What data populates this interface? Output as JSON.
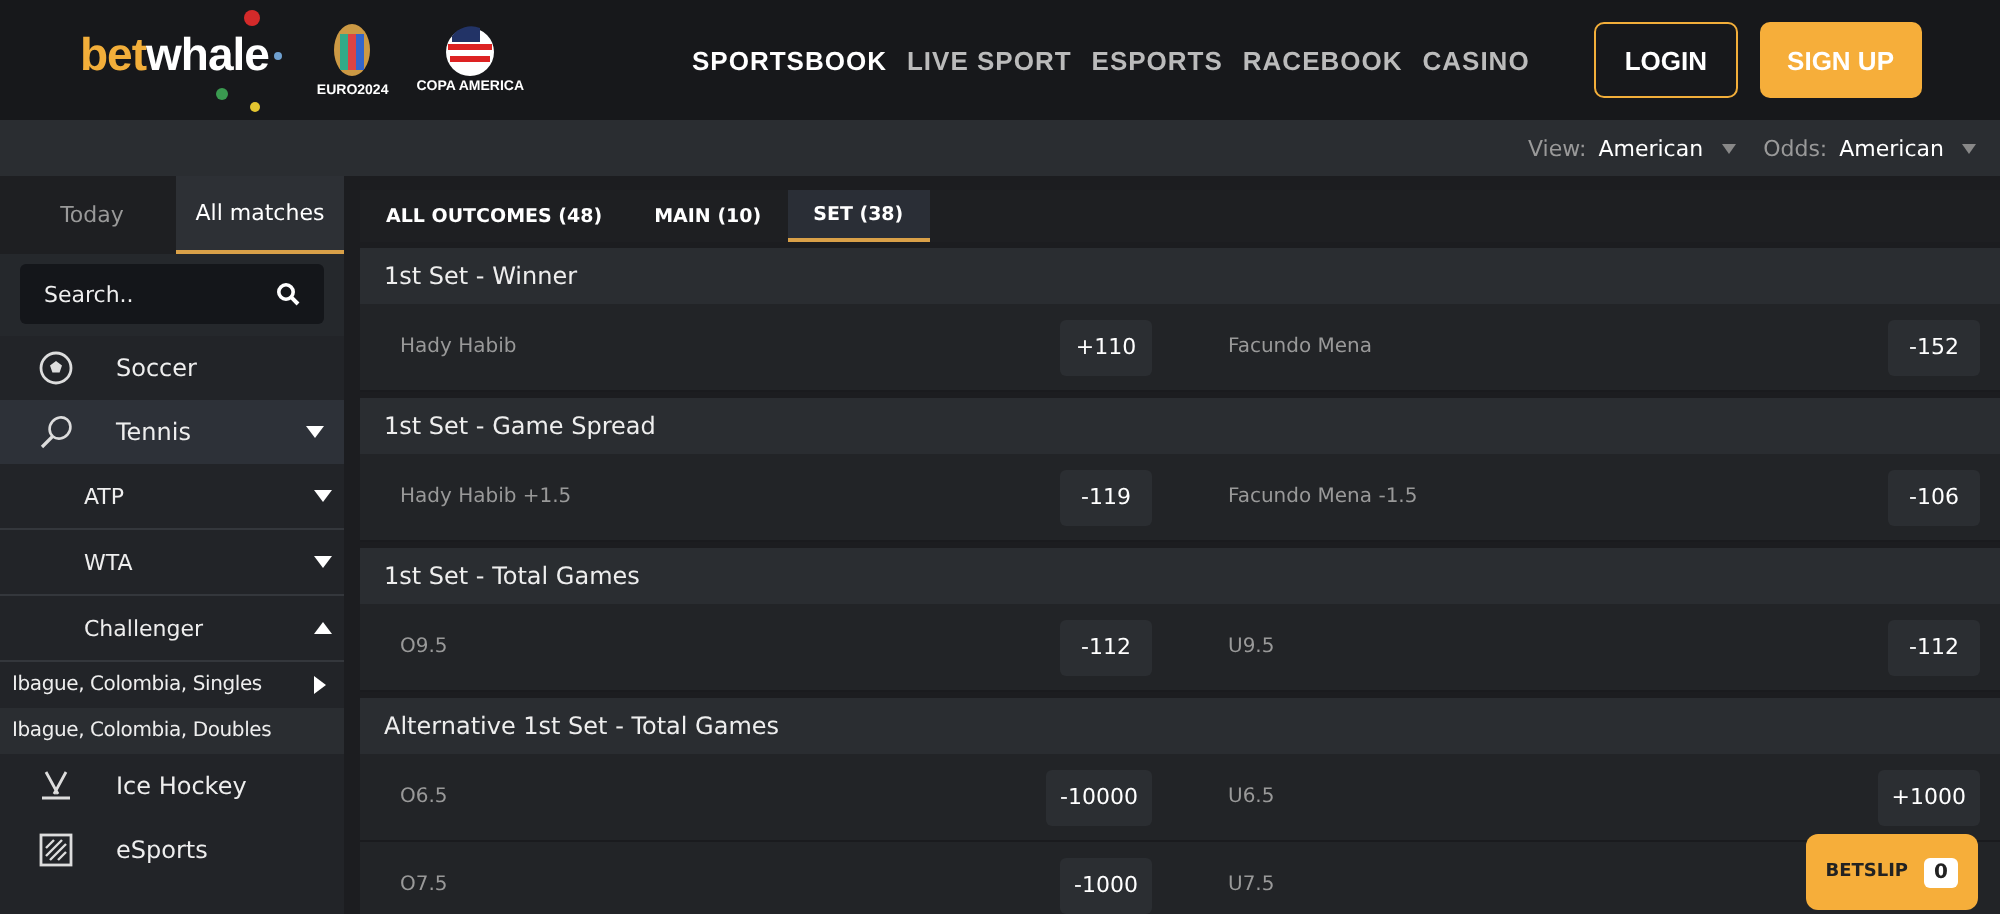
{
  "header": {
    "logo": {
      "first": "bet",
      "second": "whale"
    },
    "badges": [
      {
        "text": "EURO2024"
      },
      {
        "text": "COPA AMERICA"
      }
    ],
    "nav": [
      {
        "label": "SPORTSBOOK",
        "selected": true
      },
      {
        "label": "LIVE SPORT",
        "selected": false
      },
      {
        "label": "ESPORTS",
        "selected": false
      },
      {
        "label": "RACEBOOK",
        "selected": false
      },
      {
        "label": "CASINO",
        "selected": false
      }
    ],
    "buttons": [
      {
        "label": "LOGIN",
        "kind": "outline"
      },
      {
        "label": "SIGN UP",
        "kind": "filled"
      }
    ]
  },
  "settings": [
    {
      "label": "View:",
      "value": "American"
    },
    {
      "label": "Odds:",
      "value": "American"
    }
  ],
  "sidebar": {
    "tabs": [
      {
        "label": "Today",
        "selected": false
      },
      {
        "label": "All matches",
        "selected": true
      }
    ],
    "search": {
      "placeholder": "Search.."
    },
    "sports": [
      {
        "label": "Soccer",
        "selected": false
      },
      {
        "label": "Tennis",
        "selected": true,
        "expanded": true,
        "children": [
          {
            "label": "ATP",
            "expanded": false
          },
          {
            "label": "WTA",
            "expanded": false
          },
          {
            "label": "Challenger",
            "expanded": true,
            "children": [
              {
                "label": "Ibague, Colombia, Singles",
                "selected": false
              },
              {
                "label": "Ibague, Colombia, Doubles",
                "selected": true
              }
            ]
          }
        ]
      },
      {
        "label": "Ice Hockey",
        "selected": false
      },
      {
        "label": "eSports",
        "selected": false
      }
    ]
  },
  "market_tabs": [
    {
      "label": "ALL OUTCOMES (48)",
      "selected": false
    },
    {
      "label": "MAIN (10)",
      "selected": false
    },
    {
      "label": "SET (38)",
      "selected": true
    }
  ],
  "markets": [
    {
      "title": "1st Set - Winner",
      "rows": [
        [
          {
            "name": "Hady Habib",
            "price": "+110"
          },
          {
            "name": "Facundo Mena",
            "price": "-152"
          }
        ]
      ]
    },
    {
      "title": "1st Set - Game Spread",
      "rows": [
        [
          {
            "name": "Hady Habib +1.5",
            "price": "-119"
          },
          {
            "name": "Facundo Mena -1.5",
            "price": "-106"
          }
        ]
      ]
    },
    {
      "title": "1st Set - Total Games",
      "rows": [
        [
          {
            "name": "O9.5",
            "price": "-112"
          },
          {
            "name": "U9.5",
            "price": "-112"
          }
        ]
      ]
    },
    {
      "title": "Alternative 1st Set - Total Games",
      "rows": [
        [
          {
            "name": "O6.5",
            "price": "-10000"
          },
          {
            "name": "U6.5",
            "price": "+1000"
          }
        ],
        [
          {
            "name": "O7.5",
            "price": "-1000"
          },
          {
            "name": "U7.5"
          }
        ]
      ]
    }
  ],
  "betslip": {
    "label": "BETSLIP",
    "count": "0"
  }
}
